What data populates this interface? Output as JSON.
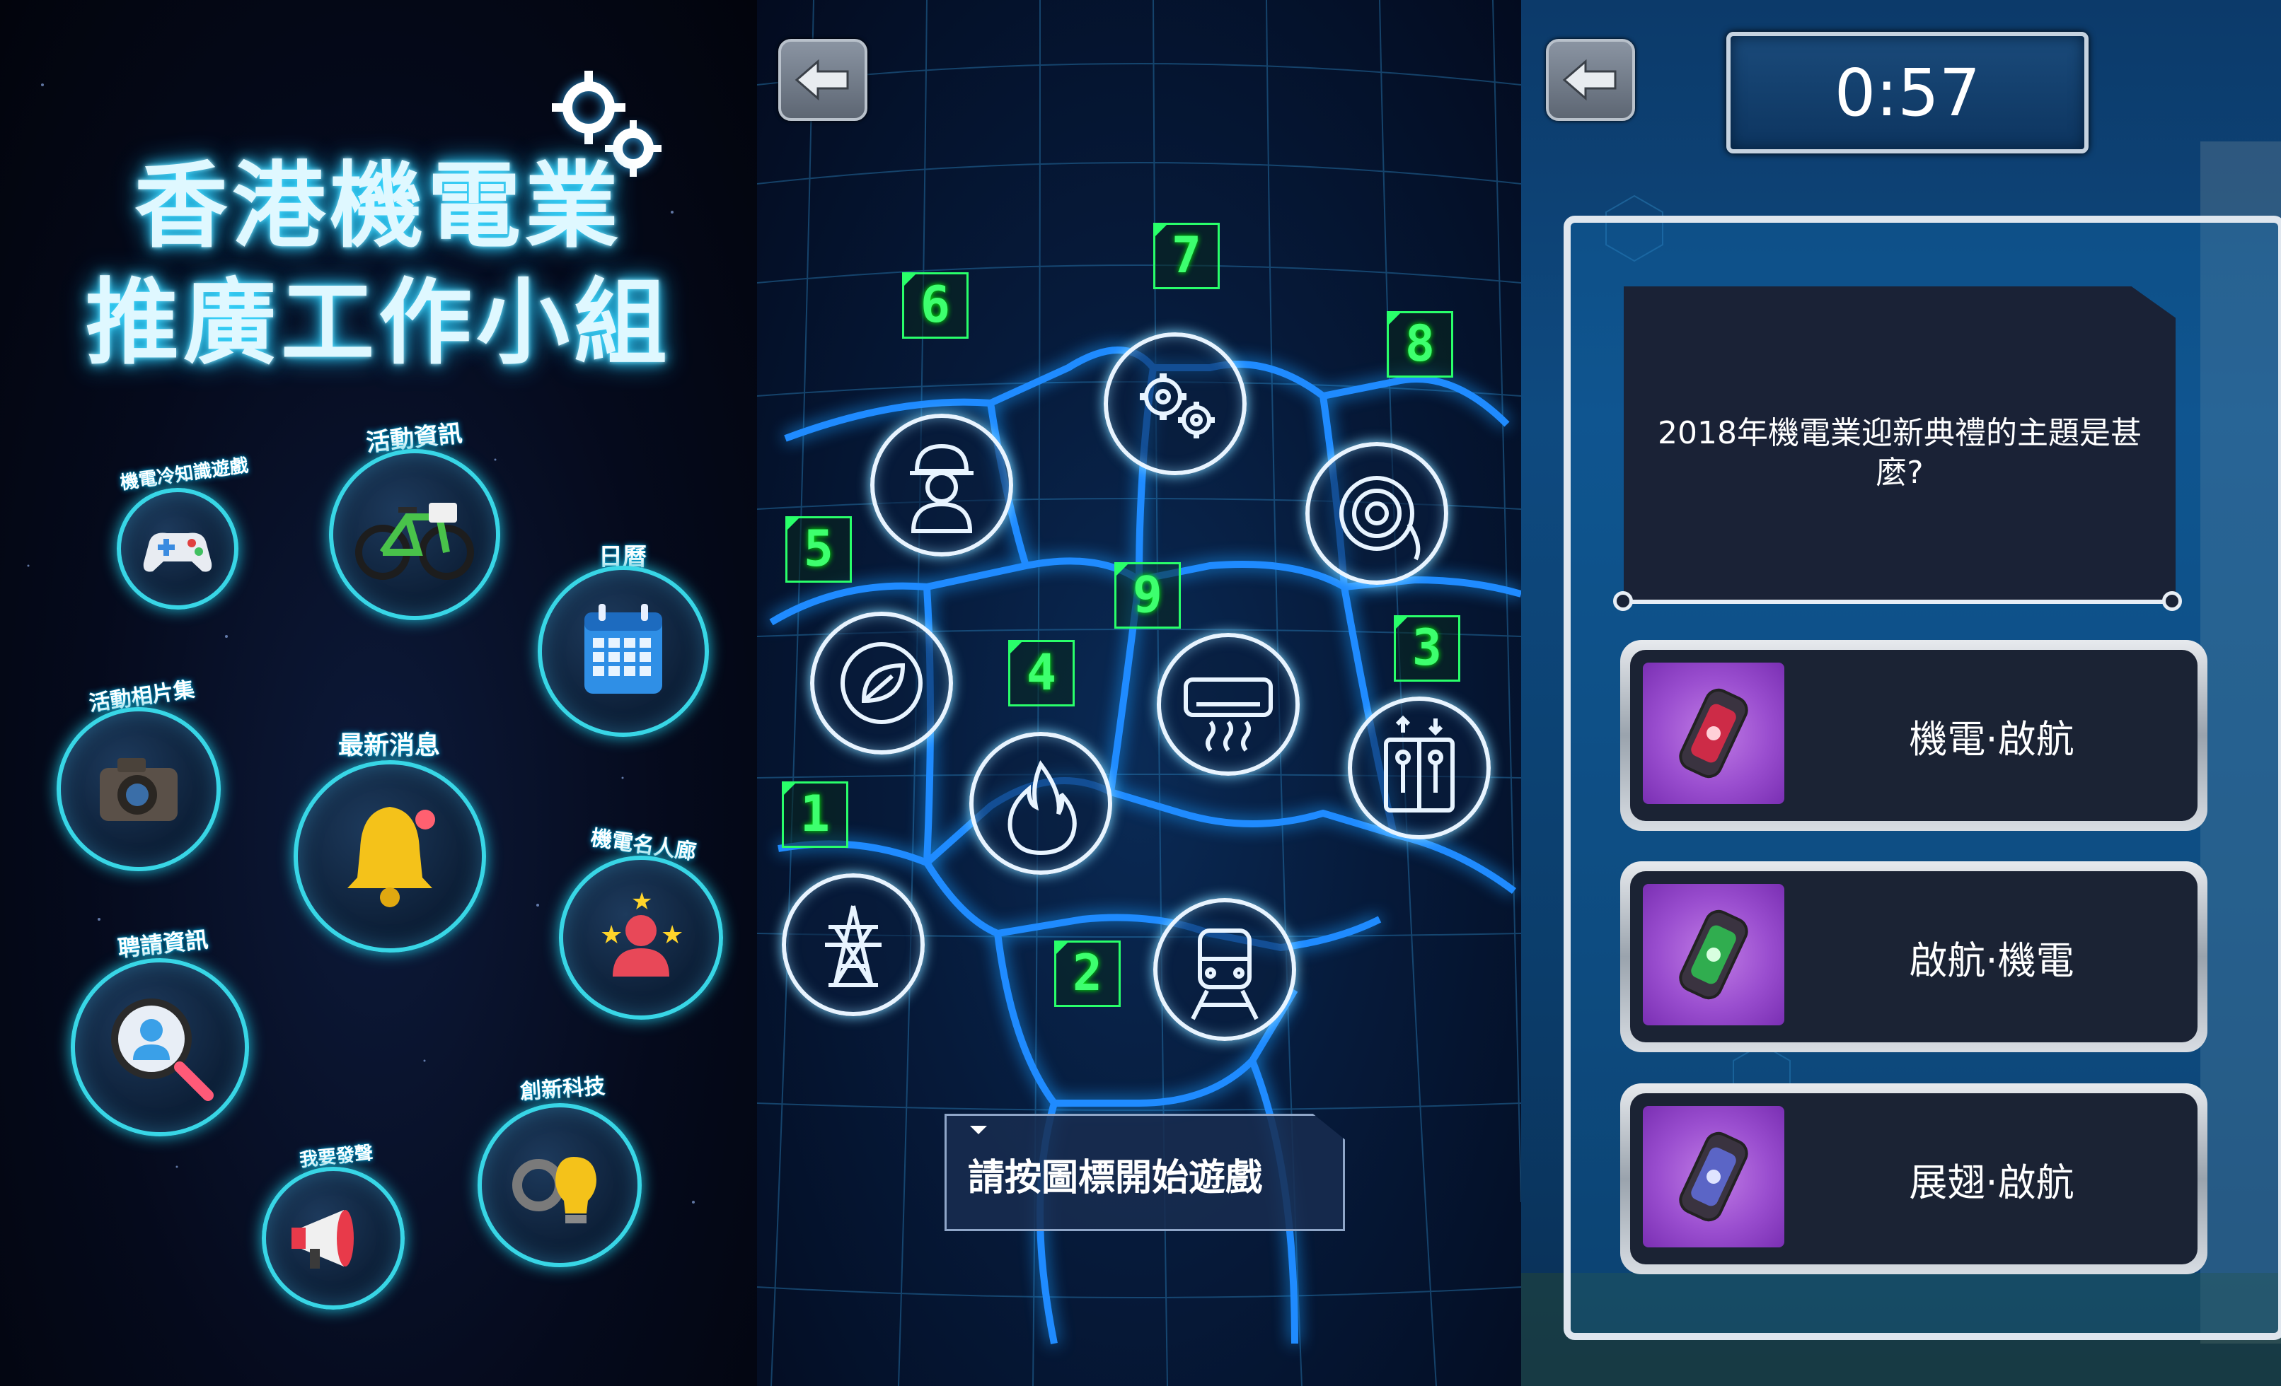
{
  "home": {
    "title_line1": "香港機電業",
    "title_line2": "推廣工作小組",
    "menu": [
      {
        "label": "機電冷知識遊戲",
        "icon": "gamepad-icon"
      },
      {
        "label": "活動資訊",
        "icon": "bicycle-icon"
      },
      {
        "label": "日曆",
        "icon": "calendar-icon"
      },
      {
        "label": "活動相片集",
        "icon": "camera-icon"
      },
      {
        "label": "最新消息",
        "icon": "bell-icon"
      },
      {
        "label": "機電名人廊",
        "icon": "star-person-icon"
      },
      {
        "label": "聘請資訊",
        "icon": "job-search-icon"
      },
      {
        "label": "創新科技",
        "icon": "lightbulb-gear-icon"
      },
      {
        "label": "我要發聲",
        "icon": "megaphone-icon"
      }
    ]
  },
  "map": {
    "nodes": [
      {
        "number": "1",
        "icon": "transmission-tower-icon"
      },
      {
        "number": "2",
        "icon": "train-icon"
      },
      {
        "number": "3",
        "icon": "lift-icon"
      },
      {
        "number": "4",
        "icon": "flame-icon"
      },
      {
        "number": "5",
        "icon": "eco-plug-icon"
      },
      {
        "number": "6",
        "icon": "engineer-icon"
      },
      {
        "number": "7",
        "icon": "gears-icon"
      },
      {
        "number": "8",
        "icon": "cable-reel-icon"
      },
      {
        "number": "9",
        "icon": "air-conditioner-icon"
      }
    ],
    "start_prompt": "請按圖標開始遊戲"
  },
  "quiz": {
    "timer": "0:57",
    "question": "2018年機電業迎新典禮的主題是甚麼?",
    "options": [
      {
        "text": "機電·啟航",
        "gem_color": "#ff2a4a"
      },
      {
        "text": "啟航·機電",
        "gem_color": "#2aff5a"
      },
      {
        "text": "展翅·啟航",
        "gem_color": "#6a7aff"
      }
    ]
  }
}
